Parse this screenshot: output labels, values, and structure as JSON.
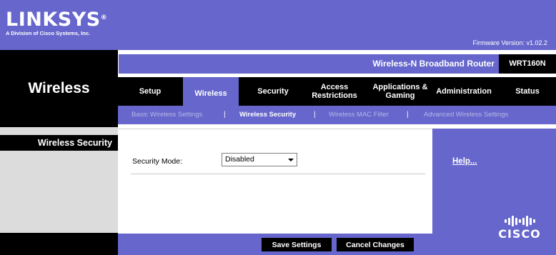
{
  "header": {
    "logo": "LINKSYS",
    "logo_mark": "®",
    "tagline": "A Division of Cisco Systems, Inc.",
    "firmware": "Firmware Version: v1.02.2"
  },
  "product": {
    "name": "Wireless-N Broadband Router",
    "model": "WRT160N"
  },
  "section_title": "Wireless",
  "tabs": [
    {
      "label": "Setup"
    },
    {
      "label": "Wireless"
    },
    {
      "label": "Security"
    },
    {
      "label": "Access\nRestrictions"
    },
    {
      "label": "Applications &\nGaming"
    },
    {
      "label": "Administration"
    },
    {
      "label": "Status"
    }
  ],
  "active_tab": "Wireless",
  "subtabs": [
    {
      "label": "Basic Wireless Settings"
    },
    {
      "label": "Wireless Security"
    },
    {
      "label": "Wireless MAC Filter"
    },
    {
      "label": "Advanced Wireless Settings"
    }
  ],
  "separator": "|",
  "active_subtab": "Wireless Security",
  "left_panel": {
    "heading": "Wireless Security"
  },
  "form": {
    "security_mode_label": "Security Mode:",
    "security_mode_value": "Disabled"
  },
  "help": {
    "label": "Help..."
  },
  "buttons": {
    "save": "Save Settings",
    "cancel": "Cancel Changes"
  },
  "footer_logo": "CISCO",
  "colors": {
    "brand": "#6666cc",
    "dark": "#000000",
    "muted_link": "#b8b8e6"
  }
}
